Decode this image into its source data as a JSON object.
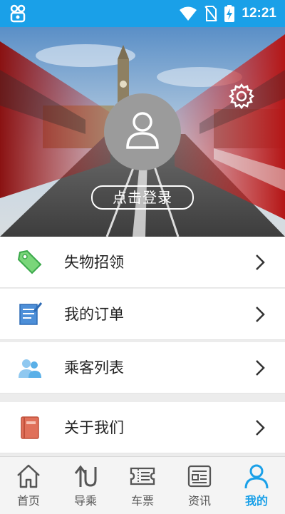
{
  "status_bar": {
    "time": "12:21"
  },
  "profile": {
    "login_label": "点击登录"
  },
  "menu": [
    {
      "label": "失物招领",
      "icon": "lost-found-tag-icon"
    },
    {
      "label": "我的订单",
      "icon": "order-document-icon"
    },
    {
      "label": "乘客列表",
      "icon": "passengers-icon"
    },
    {
      "label": "关于我们",
      "icon": "about-book-icon"
    }
  ],
  "tabs": [
    {
      "label": "首页",
      "icon": "home-icon",
      "active": false
    },
    {
      "label": "导乘",
      "icon": "transfer-arrows-icon",
      "active": false
    },
    {
      "label": "车票",
      "icon": "ticket-icon",
      "active": false
    },
    {
      "label": "资讯",
      "icon": "news-icon",
      "active": false
    },
    {
      "label": "我的",
      "icon": "profile-icon",
      "active": true
    }
  ],
  "colors": {
    "accent": "#1aa0e8",
    "avatar_bg": "#9b9b9b"
  }
}
